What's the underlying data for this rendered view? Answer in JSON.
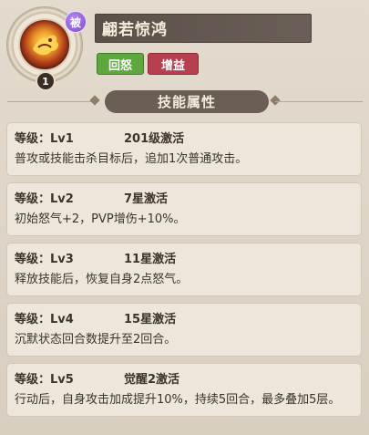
{
  "skill": {
    "name": "翩若惊鸿",
    "passive_badge": "被",
    "level_badge": "1",
    "tags": [
      "回怒",
      "增益"
    ],
    "colors": {
      "tag_green": "#5da73e",
      "tag_red": "#b64050",
      "passive_badge": "#8f5fd9"
    },
    "icon": "flame-bird-icon"
  },
  "section": {
    "title": "技能属性"
  },
  "levels": [
    {
      "level": "等级：Lv1",
      "condition": "201级激活",
      "description": "普攻或技能击杀目标后，追加1次普通攻击。"
    },
    {
      "level": "等级：Lv2",
      "condition": "7星激活",
      "description": "初始怒气+2，PVP增伤+10%。"
    },
    {
      "level": "等级：Lv3",
      "condition": "11星激活",
      "description": "释放技能后，恢复自身2点怒气。"
    },
    {
      "level": "等级：Lv4",
      "condition": "15星激活",
      "description": "沉默状态回合数提升至2回合。"
    },
    {
      "level": "等级：Lv5",
      "condition": "觉醒2激活",
      "description": "行动后，自身攻击加成提升10%，持续5回合，最多叠加5层。"
    }
  ]
}
